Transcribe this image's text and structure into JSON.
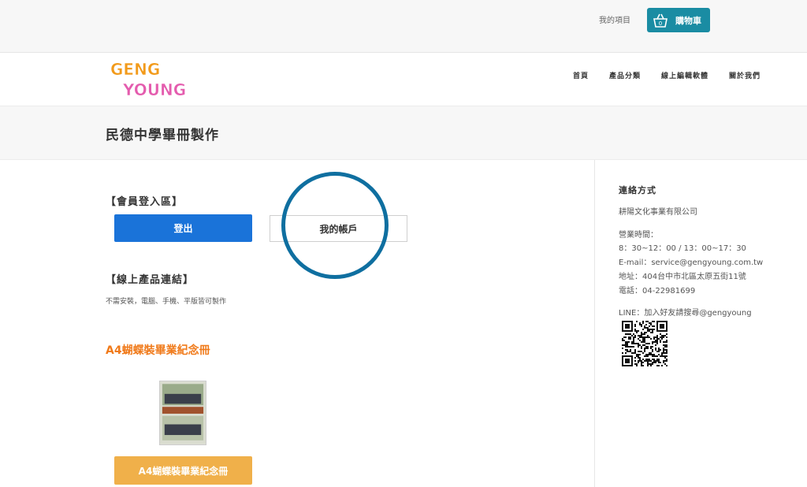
{
  "topbar": {
    "my_items": "我的項目",
    "cart_label": "購物車",
    "cart_count": "0"
  },
  "header": {
    "logo_text_1": "GENG",
    "logo_text_2": "YOUNG",
    "nav": [
      "首頁",
      "產品分類",
      "線上編輯軟體",
      "關於我們"
    ]
  },
  "page": {
    "title": "民德中學畢冊製作"
  },
  "main": {
    "member_heading": "【會員登入區】",
    "login_label": "登出",
    "account_label": "我的帳戶",
    "online_heading": "【線上產品連結】",
    "online_note": "不需安裝，電腦、手機、平版皆可製作",
    "product_title": "A4蝴蝶裝畢業紀念冊",
    "product_button": "A4蝴蝶裝畢業紀念冊"
  },
  "sidebar": {
    "heading": "連絡方式",
    "company": "耕陽文化事業有限公司",
    "hours_label": "營業時間：",
    "hours": "8：30~12：00 / 13：00~17：30",
    "email": "E-mail：service@gengyoung.com.tw",
    "address": "地址：404台中市北區太原五街11號",
    "phone": "電話：04-22981699",
    "line": "LINE：加入好友請搜尋@gengyoung"
  },
  "colors": {
    "accent_teal": "#1a8ca3",
    "login_blue": "#1a73d9",
    "product_orange": "#f07a1a",
    "product_button": "#f0b04a",
    "highlight_circle": "#0f6fa0"
  }
}
